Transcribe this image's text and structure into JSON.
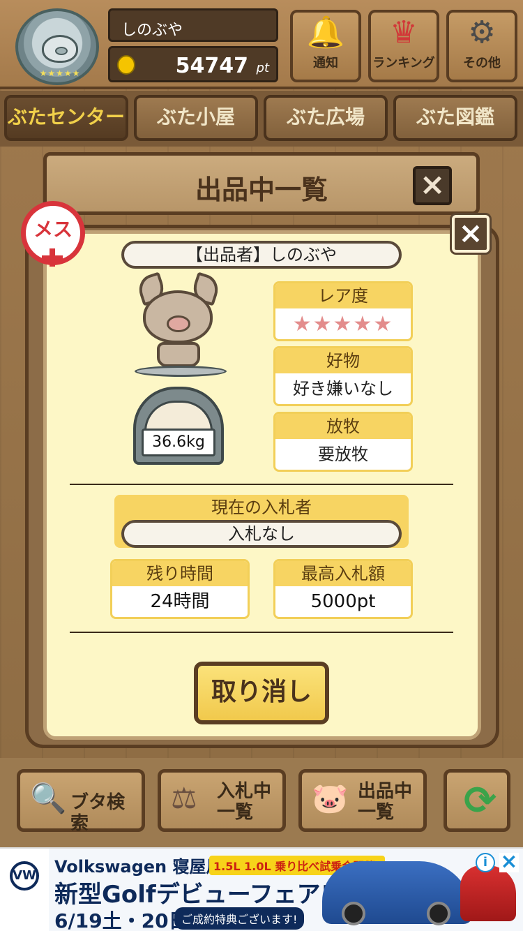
{
  "header": {
    "username": "しのぶや",
    "points_value": "54747",
    "points_unit": "pt",
    "rank_stars": "★★★★★",
    "buttons": [
      {
        "label": "通知",
        "icon": "bell-icon"
      },
      {
        "label": "ランキング",
        "icon": "crown-icon"
      },
      {
        "label": "その他",
        "icon": "gear-icon"
      }
    ]
  },
  "nav": {
    "tabs": [
      {
        "label": "ぶたセンター",
        "active": true
      },
      {
        "label": "ぶた小屋",
        "active": false
      },
      {
        "label": "ぶた広場",
        "active": false
      },
      {
        "label": "ぶた図鑑",
        "active": false
      }
    ]
  },
  "list_panel": {
    "title": "出品中一覧",
    "close_label": "×"
  },
  "detail": {
    "close_label": "×",
    "gender_label": "メス",
    "seller": "【出品者】しのぶや",
    "weight": "36.6kg",
    "rarity": {
      "label": "レア度",
      "stars": "★★★★★",
      "level": 5,
      "max": 5
    },
    "favorite": {
      "label": "好物",
      "value": "好き嫌いなし"
    },
    "grazing": {
      "label": "放牧",
      "value": "要放牧"
    },
    "current_bidder": {
      "label": "現在の入札者",
      "value": "入札なし"
    },
    "time_left": {
      "label": "残り時間",
      "value": "24時間"
    },
    "max_bid": {
      "label": "最高入札額",
      "value": "5000pt"
    },
    "cancel_label": "取り消し"
  },
  "bottom": {
    "buttons": [
      {
        "label": "ブタ検索",
        "icon": "magnifier-icon"
      },
      {
        "label": "入札中\n一覧",
        "icon": "gavel-icon"
      },
      {
        "label": "出品中\n一覧",
        "icon": "pig-icon"
      },
      {
        "label": "",
        "icon": "refresh-icon"
      }
    ]
  },
  "ad": {
    "brand": "Volkswagen 寝屋川",
    "tag": "1.5L 1.0L 乗り比べ試乗会開催!",
    "headline": "新型Golfデビューフェア!!",
    "dates": "6/19土・20日",
    "note": "ご成約特典ございます!",
    "info_label": "i",
    "close_label": "×"
  },
  "colors": {
    "wood": "#a07a4e",
    "panel_cream": "#fdf7c6",
    "accent_yellow": "#f7d462",
    "star_pink": "#e38c8c",
    "female_red": "#d8343b"
  }
}
